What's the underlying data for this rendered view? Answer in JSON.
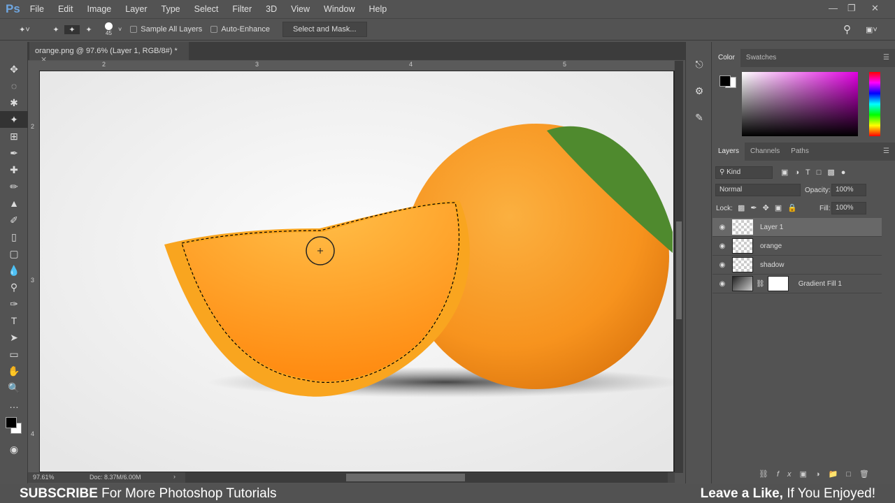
{
  "menu": {
    "logo": "Ps",
    "items": [
      "File",
      "Edit",
      "Image",
      "Layer",
      "Type",
      "Select",
      "Filter",
      "3D",
      "View",
      "Window",
      "Help"
    ]
  },
  "options": {
    "brush_size": "45",
    "sample_all_layers": "Sample All Layers",
    "auto_enhance": "Auto-Enhance",
    "select_and_mask": "Select and Mask..."
  },
  "document": {
    "tab_title": "orange.png @ 97.6% (Layer 1, RGB/8#) *",
    "ruler_top": [
      "2",
      "3",
      "4",
      "5"
    ],
    "ruler_left": [
      "2",
      "3",
      "4"
    ]
  },
  "status": {
    "zoom": "97.61%",
    "doc": "Doc: 8.37M/6.00M"
  },
  "color_panel": {
    "tabs": [
      "Color",
      "Swatches"
    ]
  },
  "layers_panel": {
    "tabs": [
      "Layers",
      "Channels",
      "Paths"
    ],
    "filter": "Kind",
    "blend_mode": "Normal",
    "opacity_label": "Opacity:",
    "opacity": "100%",
    "lock_label": "Lock:",
    "fill_label": "Fill:",
    "fill": "100%",
    "layers": [
      {
        "name": "Layer 1",
        "selected": true
      },
      {
        "name": "orange"
      },
      {
        "name": "shadow"
      },
      {
        "name": "Gradient Fill 1"
      }
    ]
  },
  "banner": {
    "left_bold": "SUBSCRIBE",
    "left_rest": " For More Photoshop Tutorials",
    "right_bold": "Leave a Like,",
    "right_rest": " If You Enjoyed!"
  },
  "colors": {
    "accent": "#6fa6e0",
    "orange": "#f7931e"
  }
}
